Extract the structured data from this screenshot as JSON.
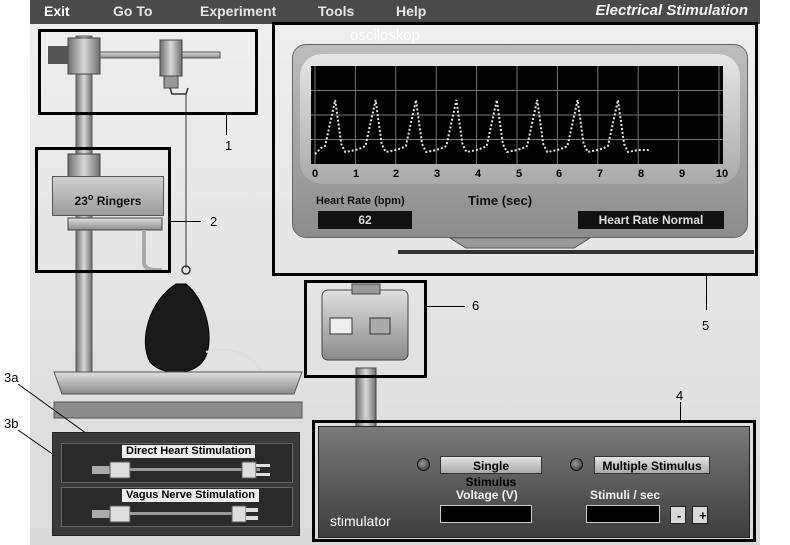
{
  "menu": {
    "exit": "Exit",
    "goto": "Go To",
    "experiment": "Experiment",
    "tools": "Tools",
    "help": "Help",
    "title": "Electrical Stimulation"
  },
  "oscilloscope": {
    "label": "osciloskop",
    "x_axis_label": "Time (sec)",
    "x_ticks": [
      "0",
      "1",
      "2",
      "3",
      "4",
      "5",
      "6",
      "7",
      "8",
      "9",
      "10"
    ],
    "heart_rate_label": "Heart Rate (bpm)",
    "heart_rate_value": "62",
    "status": "Heart Rate Normal"
  },
  "chart_data": {
    "type": "line",
    "xlabel": "Time (sec)",
    "xlim": [
      0,
      10
    ],
    "x_ticks": [
      0,
      1,
      2,
      3,
      4,
      5,
      6,
      7,
      8,
      9,
      10
    ],
    "beat_times": [
      0.2,
      1.2,
      2.2,
      3.2,
      4.2,
      5.2,
      6.2,
      7.2
    ],
    "trace_end": 8.3,
    "grid": true,
    "color": "#e6e6e6",
    "line_style": "dotted"
  },
  "equipment": {
    "ringers_temp": "23",
    "ringers_deg": "o",
    "ringers_name": "Ringers"
  },
  "callouts": {
    "c1": "1",
    "c2": "2",
    "c3a": "3a",
    "c3b": "3b",
    "c4": "4",
    "c5": "5",
    "c6": "6"
  },
  "dock": {
    "direct": "Direct Heart Stimulation",
    "vagus": "Vagus Nerve Stimulation"
  },
  "stimulator": {
    "label": "stimulator",
    "single": "Single Stimulus",
    "multiple": "Multiple Stimulus",
    "voltage_label": "Voltage (V)",
    "stimuli_label": "Stimuli / sec",
    "minus": "-",
    "plus": "+"
  },
  "colors": {
    "menubar": "#4a4a4a",
    "screen": "#000000",
    "trace": "#e6e6e6"
  }
}
